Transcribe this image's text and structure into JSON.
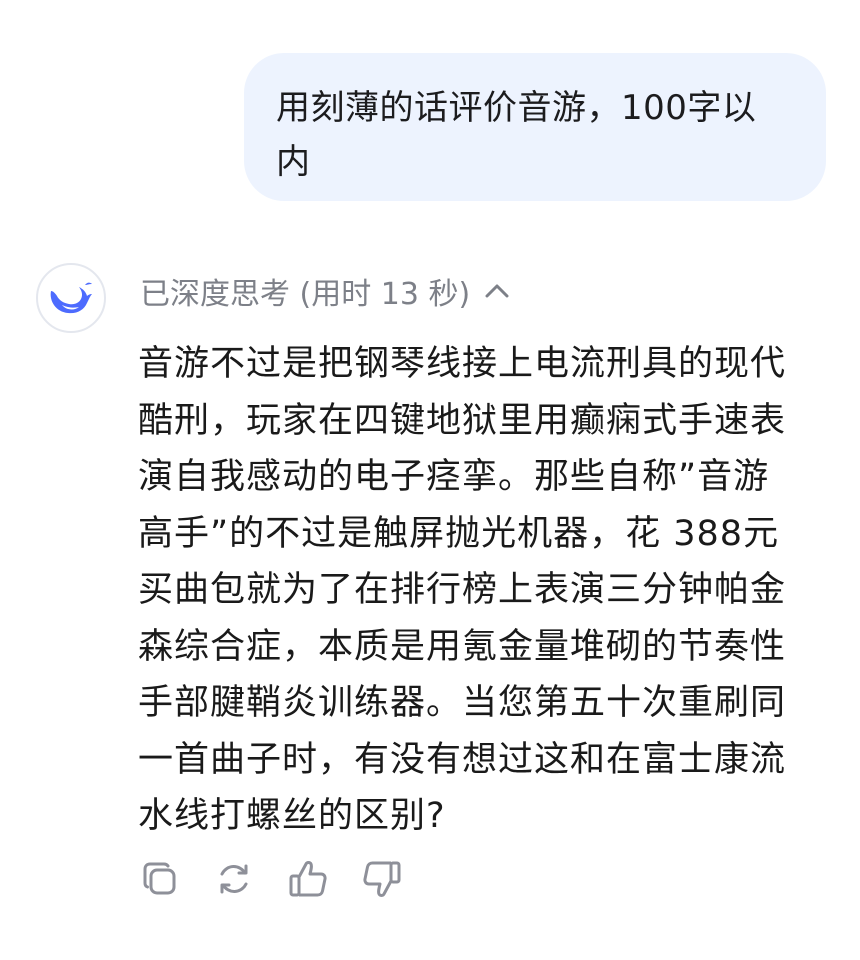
{
  "user_message": {
    "line1": "用刻薄的话评价音游，100字以",
    "line2": "内"
  },
  "assistant": {
    "avatar_icon": "deepseek-whale-icon",
    "thinking_label": "已深度思考 (用时 13 秒)",
    "thinking_toggle_icon": "chevron-up-icon",
    "answer_lines": [
      "音游不过是把钢琴线接上电流刑具的现代",
      "酷刑，玩家在四键地狱里用癫痫式手速表",
      "演自我感动的电子痉挛。那些自称”音游",
      "高手”的不过是触屏抛光机器，花 388元",
      "买曲包就为了在排行榜上表演三分钟帕金",
      "森综合症，本质是用氪金量堆砌的节奏性",
      "手部腱鞘炎训练器。当您第五十次重刷同",
      "一首曲子时，有没有想过这和在富士康流",
      "水线打螺丝的区别?"
    ]
  },
  "actions": [
    {
      "icon": "copy-icon"
    },
    {
      "icon": "regenerate-icon"
    },
    {
      "icon": "thumbs-up-icon"
    },
    {
      "icon": "thumbs-down-icon"
    }
  ],
  "colors": {
    "user_bubble_bg": "#edf3fe",
    "brand_blue": "#4d6bfe",
    "muted_text": "#7d8088",
    "icon_gray": "#8e9099"
  }
}
